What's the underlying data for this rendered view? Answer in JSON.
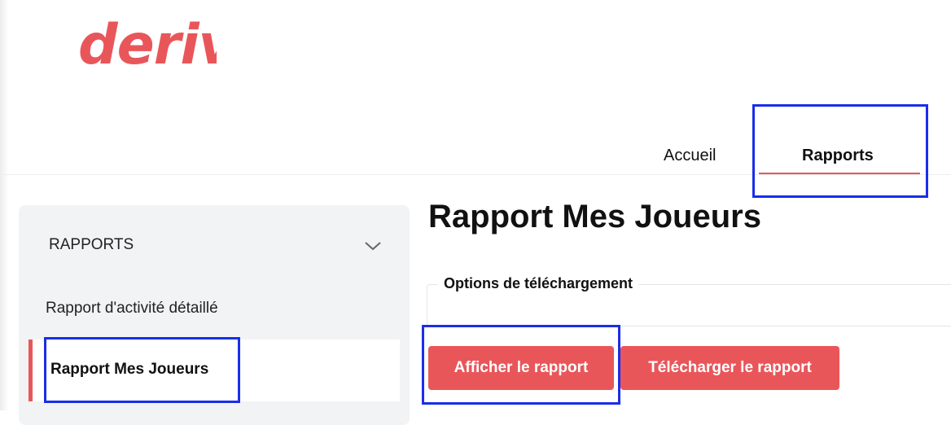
{
  "brand": {
    "name": "deriv",
    "color": "#e9565a"
  },
  "nav": {
    "items": [
      {
        "label": "Accueil",
        "active": false
      },
      {
        "label": "Rapports",
        "active": true
      }
    ]
  },
  "sidebar": {
    "section_label": "RAPPORTS",
    "section_icon": "chevron-down-icon",
    "items": [
      {
        "label": "Rapport d'activité détaillé",
        "active": false
      },
      {
        "label": "Rapport Mes Joueurs",
        "active": true
      }
    ]
  },
  "main": {
    "title": "Rapport Mes Joueurs",
    "download_options_legend": "Options de téléchargement",
    "buttons": {
      "view_label": "Afficher le rapport",
      "download_label": "Télécharger le rapport"
    }
  },
  "colors": {
    "accent": "#e9565a",
    "highlight": "#1a2ee8"
  }
}
